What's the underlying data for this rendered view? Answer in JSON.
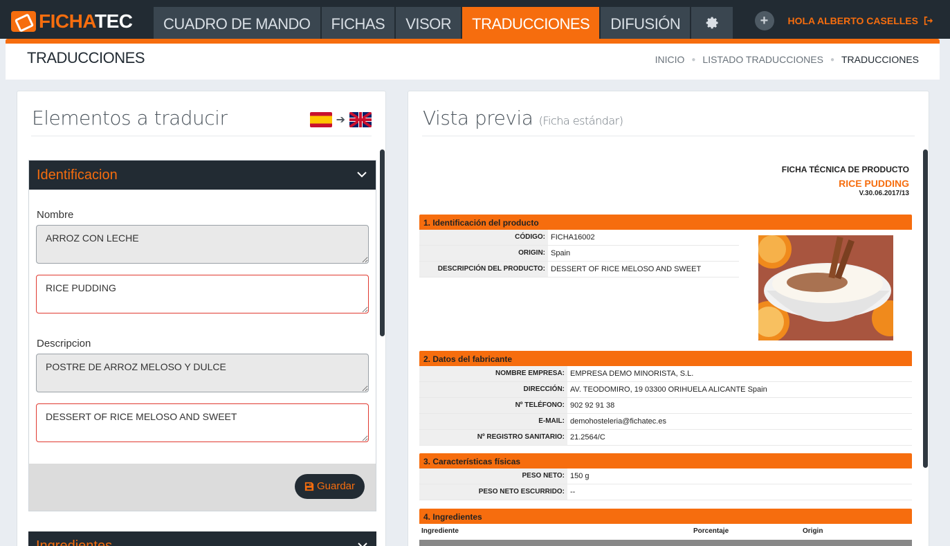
{
  "app": {
    "logo_a": "FICHA",
    "logo_b": "TEC"
  },
  "nav": {
    "tabs": [
      "CUADRO DE MANDO",
      "FICHAS",
      "VISOR",
      "TRADUCCIONES",
      "DIFUSIÓN"
    ],
    "active": "TRADUCCIONES",
    "settings_icon": "gear-icon"
  },
  "user": {
    "greeting": "HOLA ALBERTO CASELLES",
    "add_icon": "plus-icon",
    "logout_icon": "logout-icon"
  },
  "page": {
    "title": "TRADUCCIONES"
  },
  "breadcrumb": [
    "INICIO",
    "LISTADO TRADUCCIONES",
    "TRADUCCIONES"
  ],
  "left_panel": {
    "heading": "Elementos a traducir",
    "from_flag": "spain-flag-icon",
    "to_flag": "uk-flag-icon",
    "section": {
      "title": "Identificacion",
      "fields": [
        {
          "label": "Nombre",
          "source": "ARROZ CON LECHE",
          "translation": "RICE PUDDING"
        },
        {
          "label": "Descripcion",
          "source": "POSTRE DE ARROZ MELOSO Y DULCE",
          "translation": "DESSERT OF RICE MELOSO AND SWEET"
        }
      ],
      "save_label": "Guardar"
    },
    "next_section": {
      "title": "Ingredientes"
    }
  },
  "right_panel": {
    "heading": "Vista previa",
    "heading_sub": "(Ficha estándar)",
    "sheet": {
      "doc_title": "FICHA TÉCNICA DE PRODUCTO",
      "product_name": "RICE PUDDING",
      "version": "V.30.06.2017/13",
      "sections": [
        {
          "title": "1. Identificación del producto",
          "rows": [
            {
              "key": "CÓDIGO:",
              "value": "FICHA16002"
            },
            {
              "key": "ORIGIN:",
              "value": "Spain"
            },
            {
              "key": "DESCRIPCIÓN DEL PRODUCTO:",
              "value": "DESSERT OF RICE MELOSO AND SWEET"
            }
          ]
        },
        {
          "title": "2. Datos del fabricante",
          "rows": [
            {
              "key": "NOMBRE EMPRESA:",
              "value": "EMPRESA DEMO MINORISTA, S.L."
            },
            {
              "key": "DIRECCIÓN:",
              "value": "AV. TEODOMIRO, 19 03300 ORIHUELA ALICANTE Spain"
            },
            {
              "key": "Nº TELÉFONO:",
              "value": "902 92 91 38"
            },
            {
              "key": "E-MAIL:",
              "value": "demohosteleria@fichatec.es"
            },
            {
              "key": "Nº REGISTRO SANITARIO:",
              "value": "21.2564/C"
            }
          ]
        },
        {
          "title": "3. Características físicas",
          "rows": [
            {
              "key": "PESO NETO:",
              "value": "150 g"
            },
            {
              "key": "PESO NETO ESCURRIDO:",
              "value": "--"
            }
          ]
        },
        {
          "title": "4. Ingredientes",
          "columns": [
            "Ingrediente",
            "Porcentaje",
            "Origin"
          ]
        }
      ]
    }
  },
  "colors": {
    "accent": "#f66d0e",
    "dark": "#222b33",
    "nav_tab": "#3a4650"
  }
}
